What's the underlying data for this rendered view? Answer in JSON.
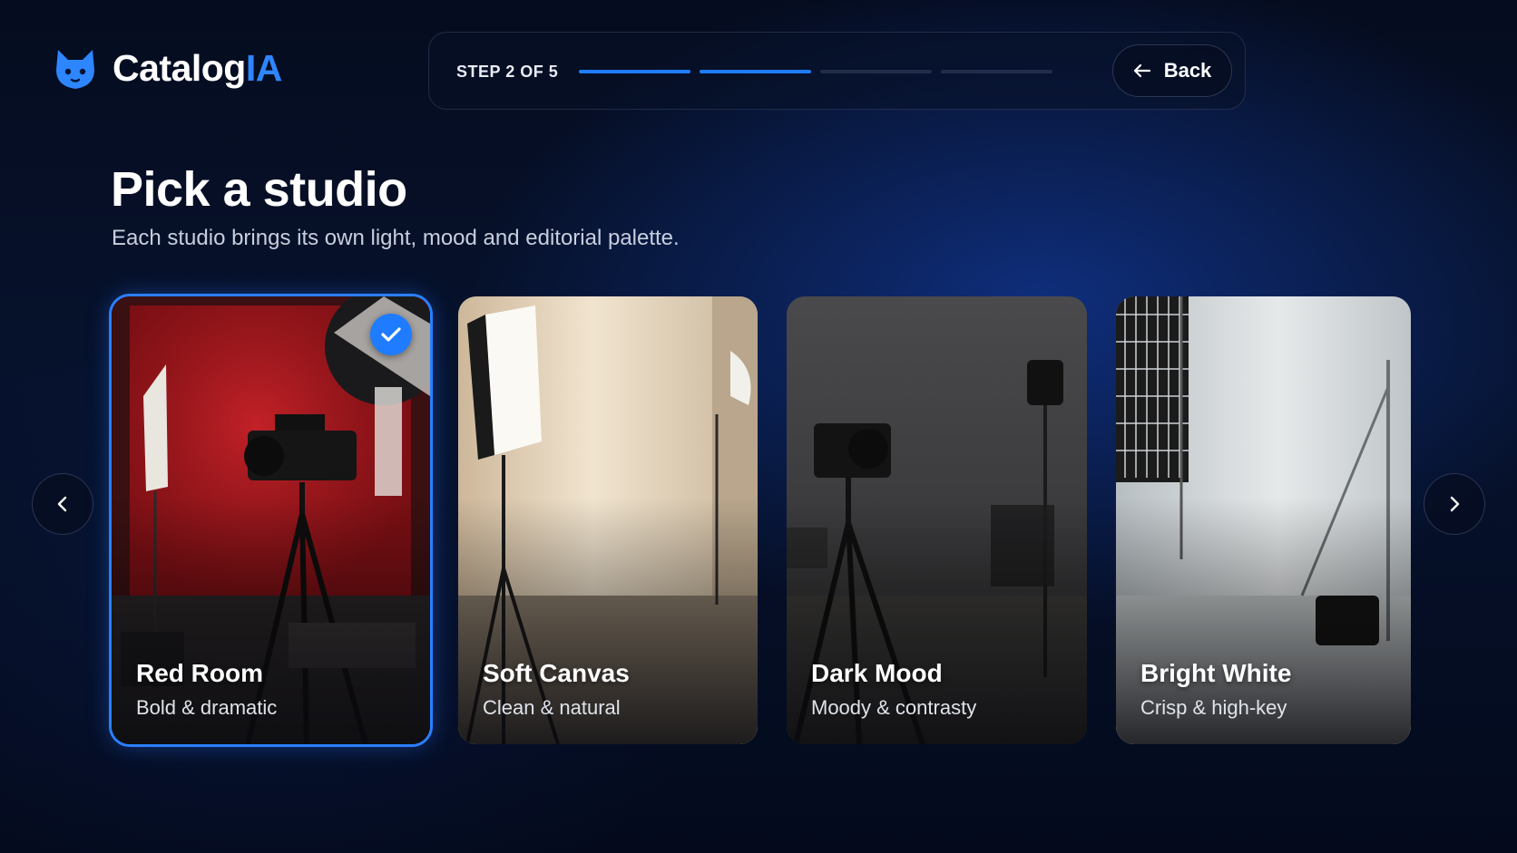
{
  "brand": {
    "name_main": "Catalog",
    "name_accent": "IA",
    "accent_color": "#2e86ff",
    "logo_icon": "fox-icon"
  },
  "stepper": {
    "label": "STEP 2 OF 5",
    "current_step": 2,
    "total_steps": 5,
    "back_label": "Back",
    "progress_color": "#1f7cff"
  },
  "page": {
    "title": "Pick a studio",
    "subtitle": "Each studio brings its own light, mood and editorial palette."
  },
  "studios": [
    {
      "title": "Red Room",
      "subtitle": "Bold & dramatic",
      "selected": true,
      "backdrop_color": "#a8161c"
    },
    {
      "title": "Soft Canvas",
      "subtitle": "Clean & natural",
      "selected": false,
      "backdrop_color": "#e8d9c0"
    },
    {
      "title": "Dark Mood",
      "subtitle": "Moody & contrasty",
      "selected": false,
      "backdrop_color": "#3a3a3c"
    },
    {
      "title": "Bright White",
      "subtitle": "Crisp & high-key",
      "selected": false,
      "backdrop_color": "#d9dde0"
    }
  ],
  "carousel": {
    "prev_icon": "chevron-left-icon",
    "next_icon": "chevron-right-icon"
  }
}
